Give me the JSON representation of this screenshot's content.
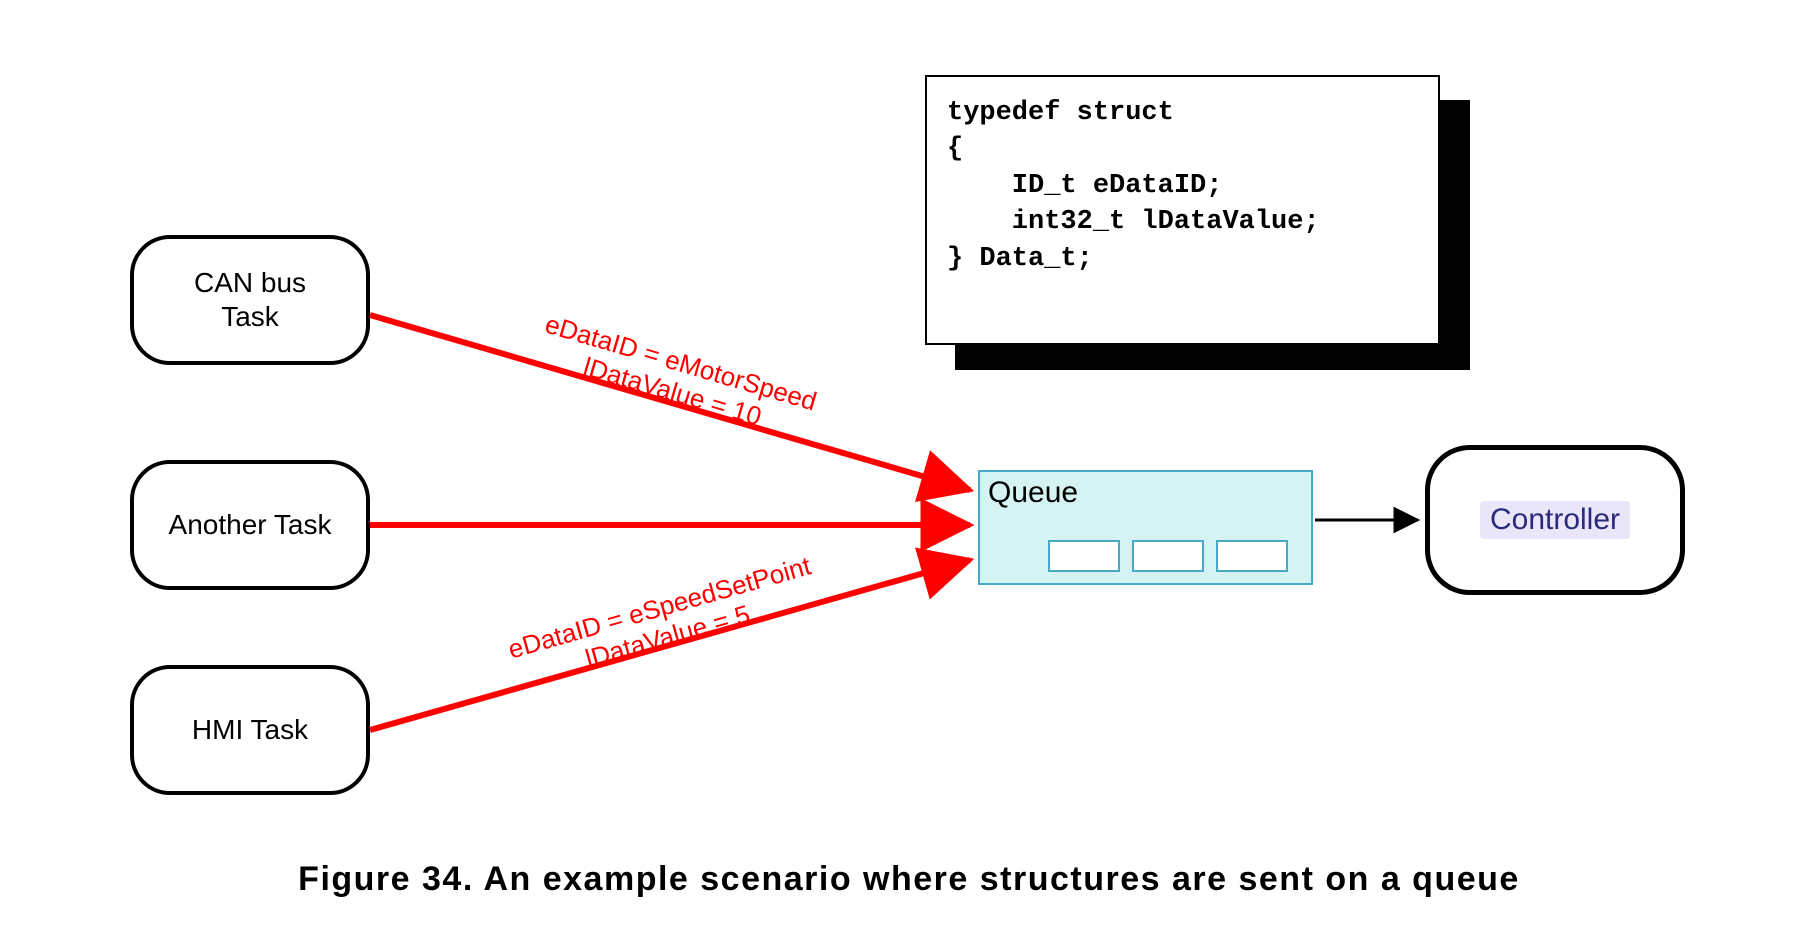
{
  "tasks": {
    "can": {
      "label": "CAN bus\nTask"
    },
    "another": {
      "label": "Another Task"
    },
    "hmi": {
      "label": "HMI Task"
    }
  },
  "queue": {
    "label": "Queue"
  },
  "controller": {
    "label": "Controller"
  },
  "arrows": {
    "top": {
      "line1": "eDataID = eMotorSpeed",
      "line2": "lDataValue = 10"
    },
    "bottom": {
      "line1": "eDataID = eSpeedSetPoint",
      "line2": "lDataValue = 5"
    }
  },
  "code": "typedef struct\n{\n    ID_t eDataID;\n    int32_t lDataValue;\n} Data_t;",
  "caption": "Figure 34.  An example scenario where structures are sent on a queue"
}
